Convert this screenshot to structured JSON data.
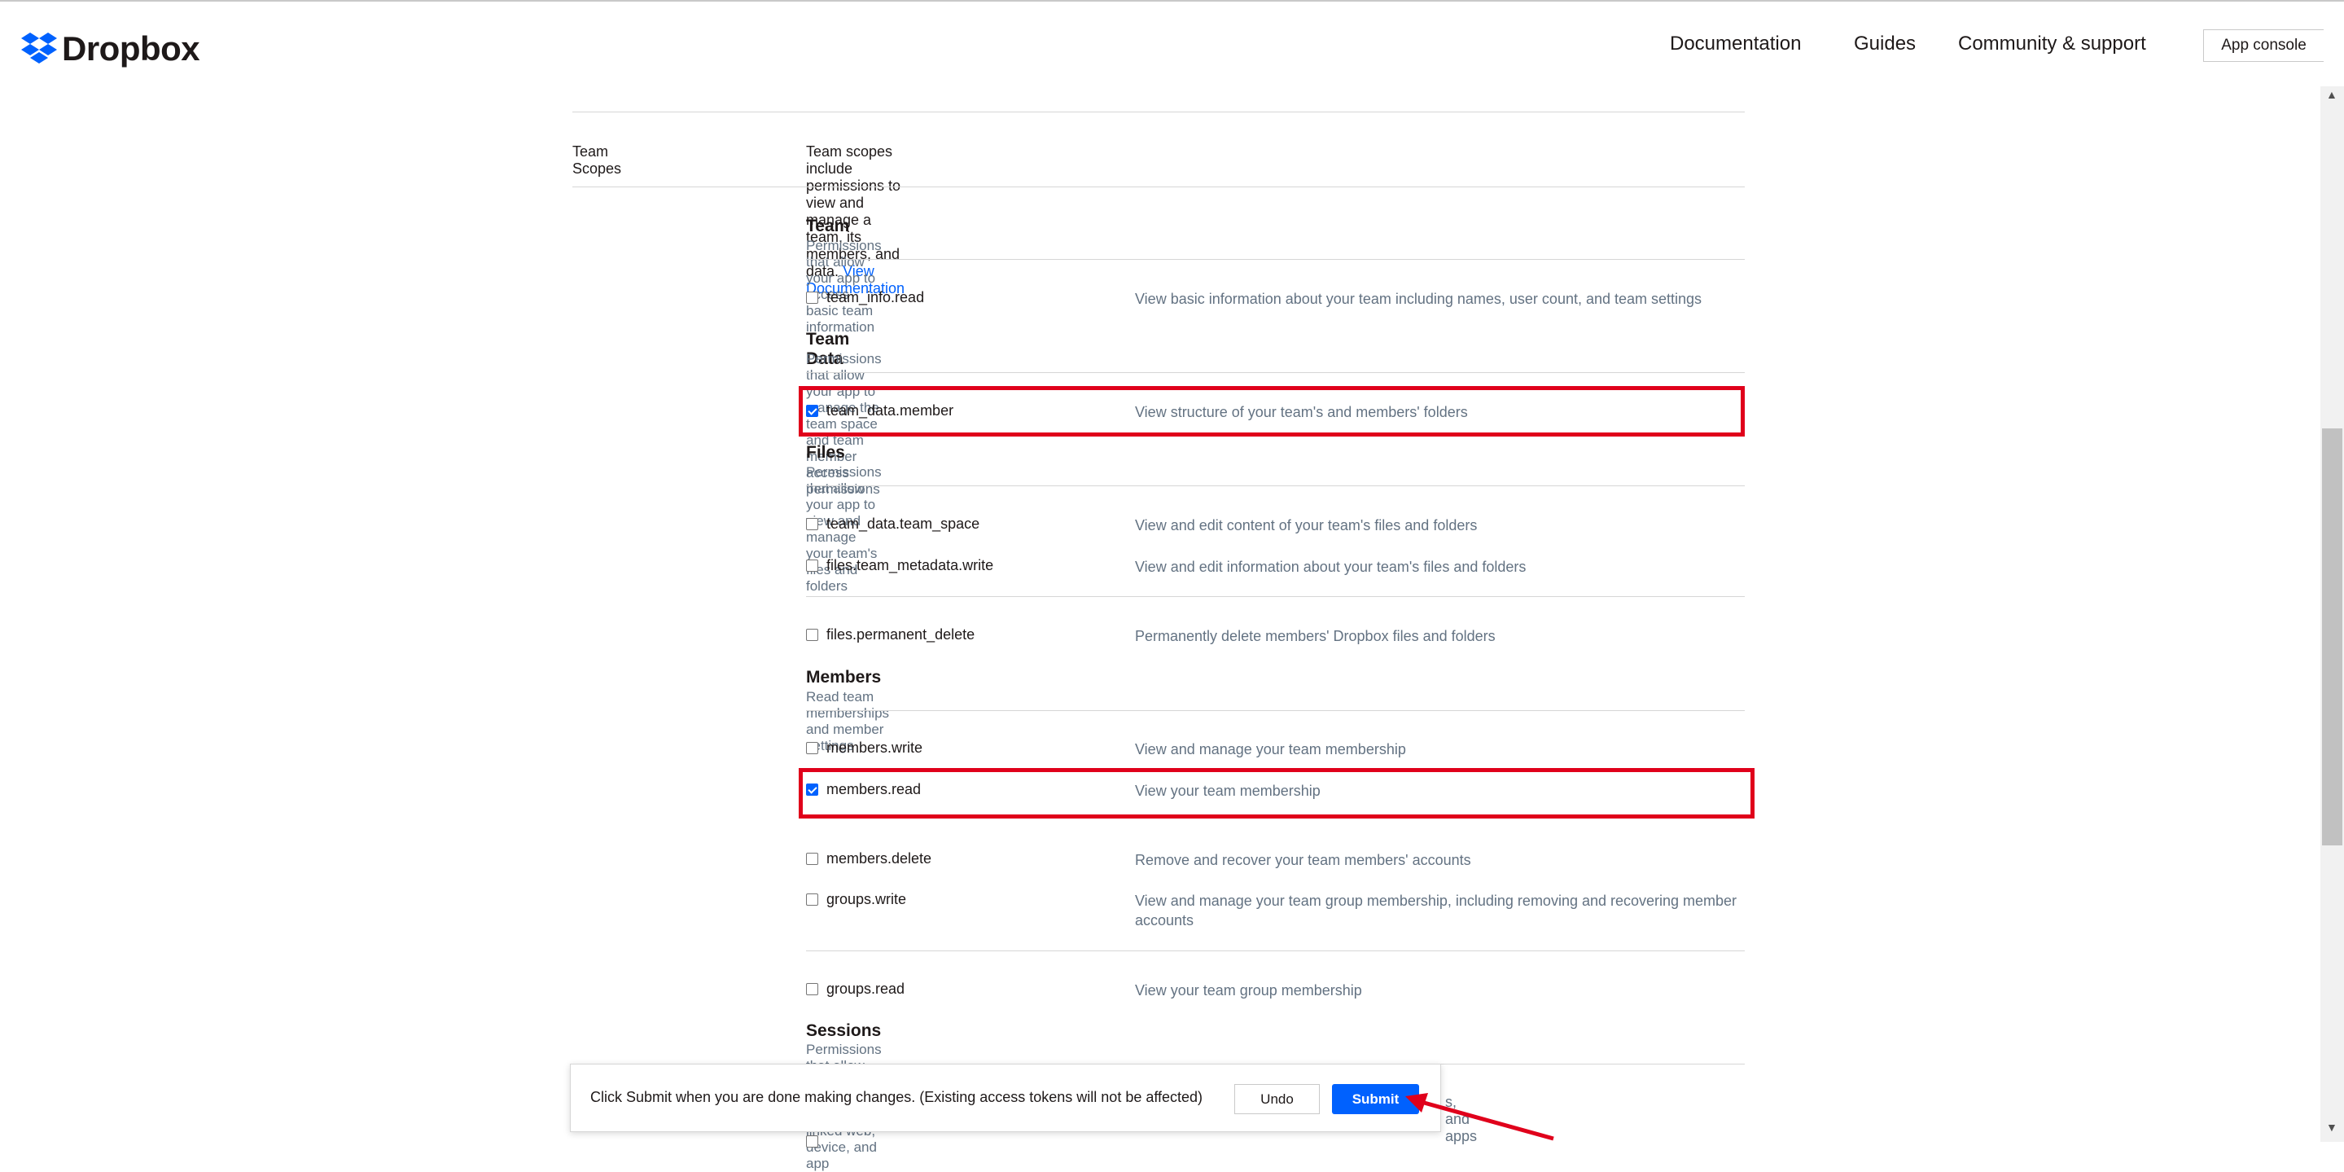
{
  "header": {
    "brand": "Dropbox",
    "nav": [
      "Documentation",
      "Guides",
      "Community & support"
    ],
    "app_console": "App console"
  },
  "team_scopes": {
    "label": "Team Scopes",
    "description": "Team scopes include permissions to view and manage a team, its members, and data.",
    "link": "View Documentation"
  },
  "sections": {
    "team": {
      "title": "Team",
      "subtitle": "Permissions that allow your app to access basic team information",
      "items": [
        {
          "name": "team_info.read",
          "desc": "View basic information about your team including names, user count, and team settings",
          "checked": false
        }
      ]
    },
    "team_data": {
      "title": "Team Data",
      "subtitle": "Permissions that allow your app to manage the team space and team member access permissions",
      "items": [
        {
          "name": "team_data.member",
          "desc": "View structure of your team's and members' folders",
          "checked": true
        }
      ]
    },
    "files": {
      "title": "Files",
      "subtitle": "Permissions that allow your app to view and manage your team's files and folders",
      "items": [
        {
          "name": "team_data.team_space",
          "desc": "View and edit content of your team's files and folders",
          "checked": false
        },
        {
          "name": "files.team_metadata.write",
          "desc": "View and edit information about your team's files and folders",
          "checked": false
        },
        {
          "name": "files.permanent_delete",
          "desc": "Permanently delete members' Dropbox files and folders",
          "checked": false
        }
      ]
    },
    "members": {
      "title": "Members",
      "subtitle": "Read team memberships and member settings",
      "items": [
        {
          "name": "members.write",
          "desc": "View and manage your team membership",
          "checked": false
        },
        {
          "name": "members.read",
          "desc": "View your team membership",
          "checked": true
        },
        {
          "name": "members.delete",
          "desc": "Remove and recover your team members' accounts",
          "checked": false
        },
        {
          "name": "groups.write",
          "desc": "View and manage your team group membership, including removing and recovering member accounts",
          "checked": false
        },
        {
          "name": "groups.read",
          "desc": "View your team group membership",
          "checked": false
        }
      ]
    },
    "sessions": {
      "title": "Sessions",
      "subtitle": "Permissions that allow your app to view and manage linked web, device, and app",
      "partial_desc": "s, and apps"
    }
  },
  "toast": {
    "message": "Click Submit when you are done making changes. (Existing access tokens will not be affected)",
    "undo": "Undo",
    "submit": "Submit"
  },
  "colors": {
    "accent": "#0061fe",
    "highlight": "#e0001b"
  }
}
